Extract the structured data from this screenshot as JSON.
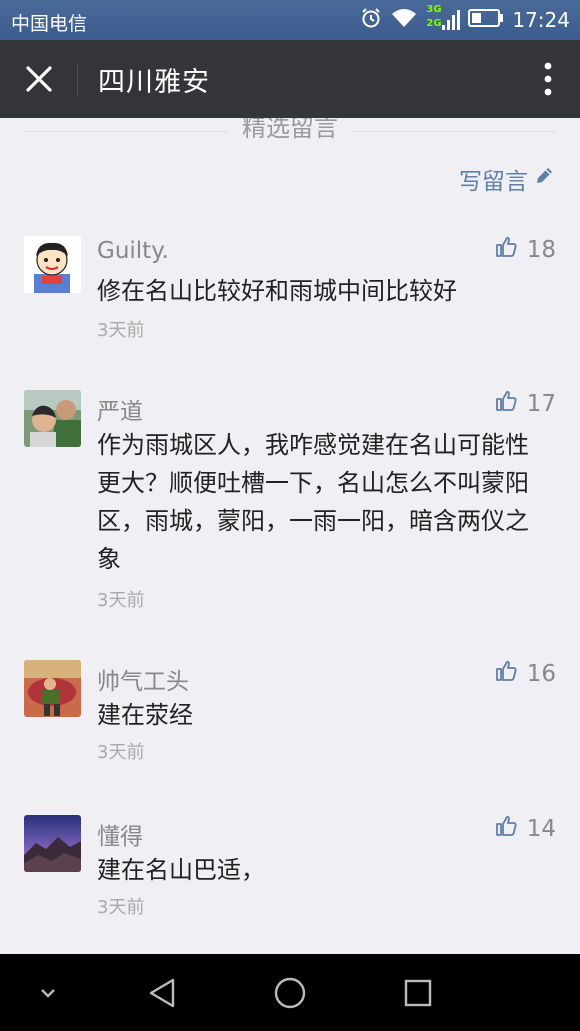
{
  "status_bar": {
    "carrier": "中国电信",
    "network_top": "3G",
    "network_bottom": "2G",
    "time": "17:24",
    "icons": [
      "alarm-icon",
      "wifi-icon",
      "signal-icon",
      "battery-icon"
    ]
  },
  "title_bar": {
    "title": "四川雅安",
    "close_icon": "close-icon",
    "more_icon": "more-vertical-icon"
  },
  "section": {
    "title": "精选留言",
    "write_label": "写留言"
  },
  "comments": [
    {
      "name": "Guilty.",
      "likes": "18",
      "text": "修在名山比较好和雨城中间比较好",
      "time": "3天前"
    },
    {
      "name": "严道",
      "likes": "17",
      "text": "作为雨城区人，我咋感觉建在名山可能性更大？顺便吐槽一下，名山怎么不叫蒙阳区，雨城，蒙阳，一雨一阳，暗含两仪之象",
      "time": "3天前"
    },
    {
      "name": "帅气工头",
      "likes": "16",
      "text": "建在荥经",
      "time": "3天前"
    },
    {
      "name": "懂得",
      "likes": "14",
      "text": "建在名山巴适，",
      "time": "3天前"
    }
  ],
  "nav_bar": {
    "icons": [
      "chevron-down-icon",
      "back-triangle-icon",
      "home-circle-icon",
      "recents-square-icon"
    ]
  },
  "colors": {
    "accent_link": "#607fa6",
    "title_bar_bg": "#333539",
    "status_bar_bg": "#3b5c8c",
    "page_bg": "#efeff4"
  }
}
